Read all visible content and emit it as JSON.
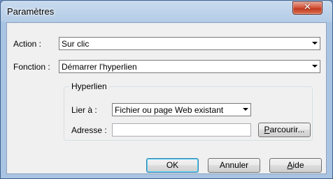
{
  "window": {
    "title": "Paramètres",
    "close_glyph": "✕"
  },
  "action": {
    "label": "Action :",
    "value": "Sur clic"
  },
  "fonction": {
    "label": "Fonction :",
    "value": "Démarrer l'hyperlien"
  },
  "hyperlien": {
    "group_title": "Hyperlien",
    "lier_label": "Lier à :",
    "lier_value": "Fichier ou page Web existant",
    "adresse_label": "Adresse :",
    "adresse_value": "",
    "browse_mnemonic": "P",
    "browse_rest": "arcourir..."
  },
  "buttons": {
    "ok": "OK",
    "cancel": "Annuler",
    "help_mnemonic": "A",
    "help_rest": "ide"
  },
  "icons": {
    "dropdown": "chevron-down-icon",
    "close": "close-icon"
  }
}
